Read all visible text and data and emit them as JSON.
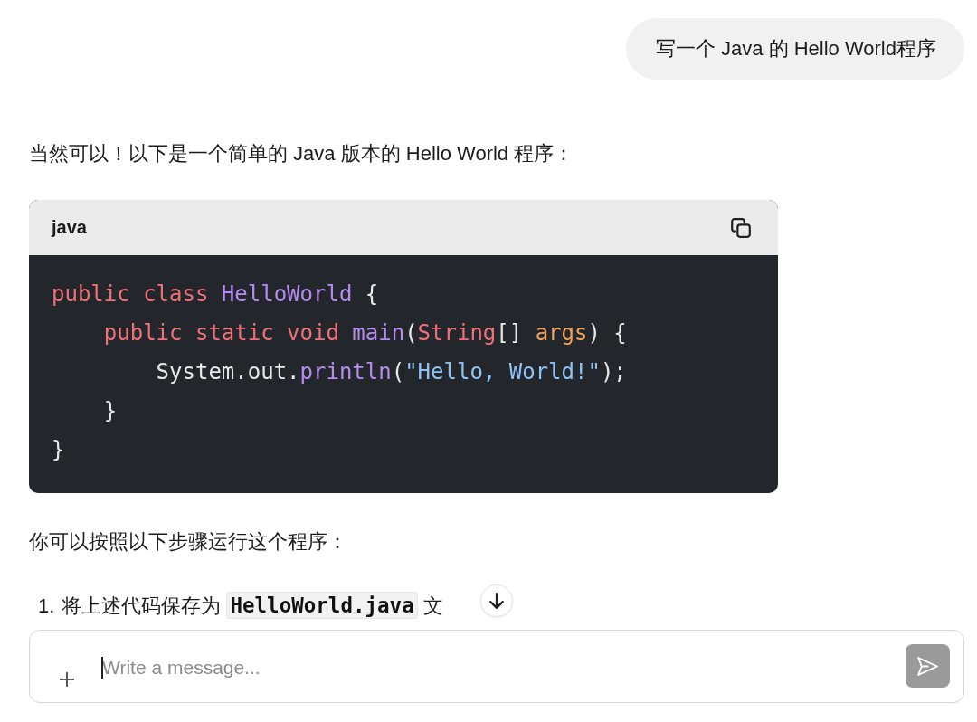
{
  "user_message": {
    "text": "写一个 Java 的 Hello World程序"
  },
  "reply": {
    "intro": "当然可以！以下是一个简单的 Java 版本的 Hello World 程序：",
    "code_block": {
      "language": "java",
      "lines": [
        {
          "tokens": [
            {
              "kind": "keyword",
              "text": "public class "
            },
            {
              "kind": "class_name",
              "text": "HelloWorld"
            },
            {
              "kind": "plain",
              "text": " {"
            }
          ]
        },
        {
          "tokens": [
            {
              "kind": "keyword",
              "text": "    public static void "
            },
            {
              "kind": "function",
              "text": "main"
            },
            {
              "kind": "plain",
              "text": "("
            },
            {
              "kind": "type",
              "text": "String"
            },
            {
              "kind": "plain",
              "text": "[] "
            },
            {
              "kind": "param",
              "text": "args"
            },
            {
              "kind": "plain",
              "text": ") {"
            }
          ]
        },
        {
          "tokens": [
            {
              "kind": "plain",
              "text": "        System.out."
            },
            {
              "kind": "function",
              "text": "println"
            },
            {
              "kind": "plain",
              "text": "("
            },
            {
              "kind": "string",
              "text": "\"Hello, World!\""
            },
            {
              "kind": "plain",
              "text": ");"
            }
          ]
        },
        {
          "tokens": [
            {
              "kind": "plain",
              "text": "    }"
            }
          ]
        },
        {
          "tokens": [
            {
              "kind": "plain",
              "text": "}"
            }
          ]
        }
      ]
    },
    "outro": "你可以按照以下步骤运行这个程序：",
    "steps": [
      {
        "number": "1.",
        "parts": [
          {
            "kind": "text",
            "text": "将上述代码保存为 "
          },
          {
            "kind": "code",
            "text": "HelloWorld.java"
          },
          {
            "kind": "text",
            "text": " 文"
          }
        ]
      }
    ]
  },
  "composer": {
    "placeholder": "Write a message...",
    "send_button": {
      "disabled": true
    }
  }
}
